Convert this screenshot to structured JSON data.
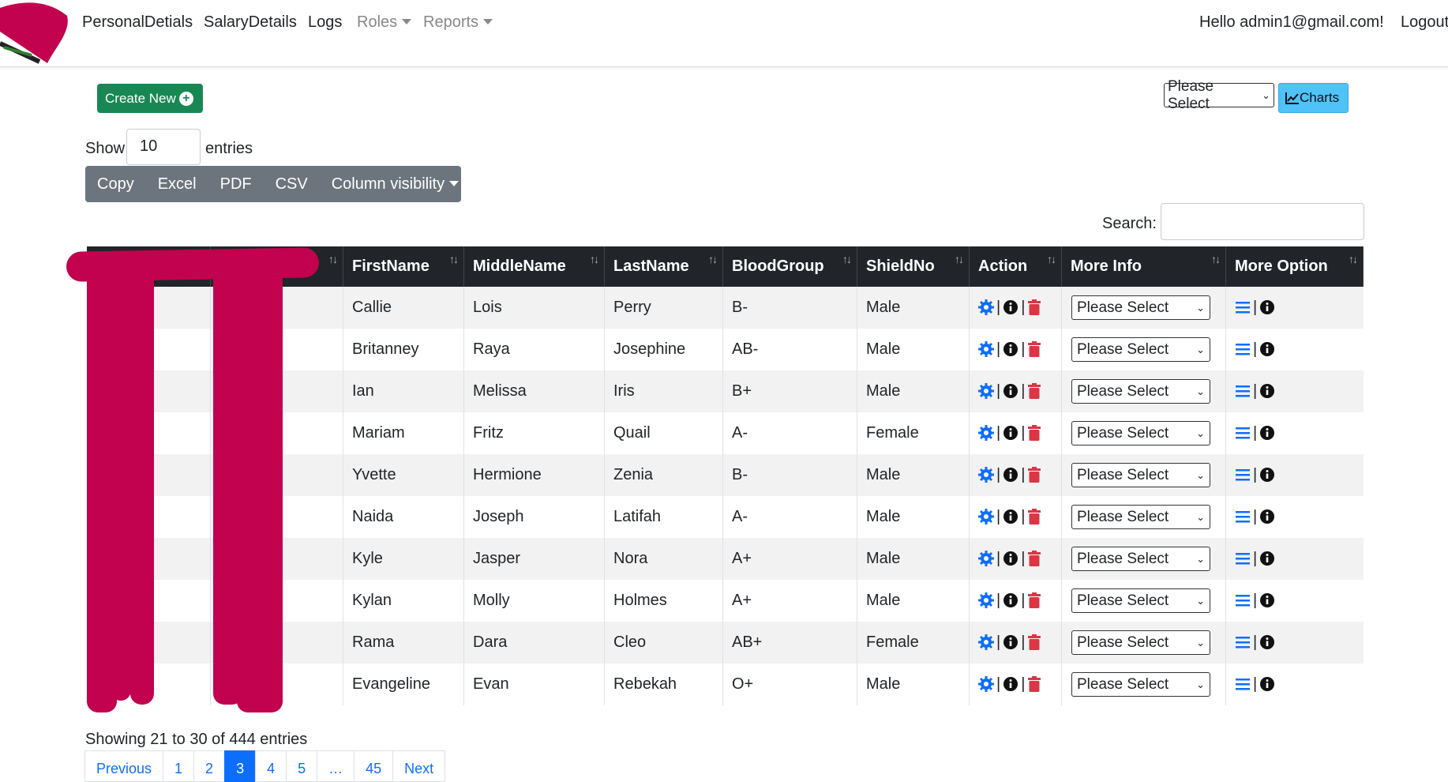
{
  "nav": {
    "items": [
      "PersonalDetials",
      "SalaryDetails",
      "Logs"
    ],
    "roles": "Roles",
    "reports": "Reports",
    "greeting": "Hello admin1@gmail.com!",
    "logout": "Logout"
  },
  "toolbar": {
    "create_label": "Create New",
    "select_label": "Please Select",
    "charts_label": "Charts",
    "show_label": "Show",
    "show_value": "10",
    "entries_label": "entries",
    "buttons": [
      "Copy",
      "Excel",
      "PDF",
      "CSV",
      "Column visibility"
    ],
    "search_label": "Search:"
  },
  "table": {
    "headers": [
      "FirstName",
      "MiddleName",
      "LastName",
      "BloodGroup",
      "ShieldNo",
      "Action",
      "More Info",
      "More Option"
    ],
    "select_placeholder": "Please Select",
    "rows": [
      [
        "Callie",
        "Lois",
        "Perry",
        "B-",
        "Male"
      ],
      [
        "Britanney",
        "Raya",
        "Josephine",
        "AB-",
        "Male"
      ],
      [
        "Ian",
        "Melissa",
        "Iris",
        "B+",
        "Male"
      ],
      [
        "Mariam",
        "Fritz",
        "Quail",
        "A-",
        "Female"
      ],
      [
        "Yvette",
        "Hermione",
        "Zenia",
        "B-",
        "Male"
      ],
      [
        "Naida",
        "Joseph",
        "Latifah",
        "A-",
        "Male"
      ],
      [
        "Kyle",
        "Jasper",
        "Nora",
        "A+",
        "Male"
      ],
      [
        "Kylan",
        "Molly",
        "Holmes",
        "A+",
        "Male"
      ],
      [
        "Rama",
        "Dara",
        "Cleo",
        "AB+",
        "Female"
      ],
      [
        "Evangeline",
        "Evan",
        "Rebekah",
        "O+",
        "Male"
      ]
    ]
  },
  "footer": {
    "info": "Showing 21 to 30 of 444 entries",
    "pages": [
      "Previous",
      "1",
      "2",
      "3",
      "4",
      "5",
      "…",
      "45",
      "Next"
    ],
    "active_page": "3"
  },
  "colors": {
    "create": "#198754",
    "charts": "#4fc3f7",
    "header": "#212529",
    "gear": "#0d6efd",
    "trash": "#dc3545",
    "redaction": "#c2024f"
  },
  "icons": {
    "action": [
      "gear-icon",
      "info-icon",
      "trash-icon"
    ],
    "more_option": [
      "list-icon",
      "info-icon"
    ]
  }
}
